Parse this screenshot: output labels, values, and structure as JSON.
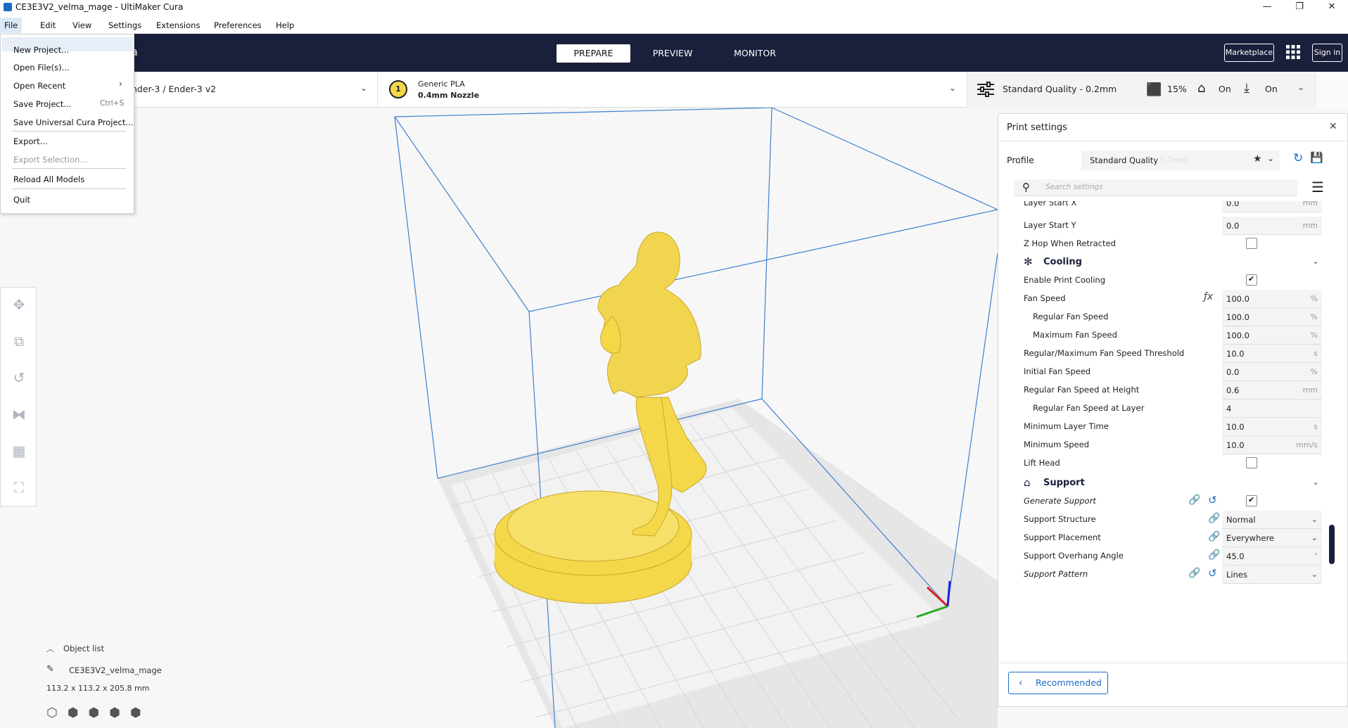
{
  "window": {
    "title": "CE3E3V2_velma_mage - UltiMaker Cura",
    "controls": [
      "—",
      "❐",
      "✕"
    ]
  },
  "menubar": [
    "File",
    "Edit",
    "View",
    "Settings",
    "Extensions",
    "Preferences",
    "Help"
  ],
  "header": {
    "tabs": [
      "PREPARE",
      "PREVIEW",
      "MONITOR"
    ],
    "active_tab": "PREPARE",
    "marketplace_label": "Marketplace",
    "signin_label": "Sign in",
    "logo_fragment": "a"
  },
  "toolbar": {
    "printer": "nder-3 / Ender-3 v2",
    "material_index": "1",
    "material_name": "Generic PLA",
    "nozzle": "0.4mm Nozzle",
    "quality": "Standard Quality - 0.2mm",
    "infill": "15%",
    "support": "On",
    "adhesion": "On"
  },
  "file_menu": {
    "items": [
      {
        "label": "New Project...",
        "shortcut": "",
        "disabled": false
      },
      {
        "label": "Open File(s)...",
        "shortcut": "",
        "disabled": false
      },
      {
        "label": "Open Recent",
        "shortcut": "›",
        "disabled": false
      },
      {
        "label": "Save Project...",
        "shortcut": "Ctrl+S",
        "disabled": false
      },
      {
        "label": "Save Universal Cura Project...",
        "shortcut": "",
        "disabled": false
      },
      {
        "label": "Export...",
        "shortcut": "",
        "disabled": false
      },
      {
        "label": "Export Selection...",
        "shortcut": "",
        "disabled": true
      },
      {
        "label": "Reload All Models",
        "shortcut": "",
        "disabled": false
      },
      {
        "label": "Quit",
        "shortcut": "",
        "disabled": false
      }
    ]
  },
  "object_list": {
    "title": "Object list",
    "object_name": "CE3E3V2_velma_mage",
    "dimensions": "113.2 x 113.2 x 205.8 mm"
  },
  "print_settings": {
    "title": "Print settings",
    "profile_label": "Profile",
    "profile_value": "Standard Quality",
    "profile_suffix": "0.2mm",
    "search_placeholder": "Search settings",
    "partial_row": "Layer Start X",
    "partial_row_value": "0.0",
    "partial_row_unit": "mm",
    "layer_start_y": {
      "label": "Layer Start Y",
      "value": "0.0",
      "unit": "mm"
    },
    "z_hop": {
      "label": "Z Hop When Retracted"
    },
    "cooling": {
      "title": "Cooling",
      "enable_print_cooling": "Enable Print Cooling",
      "rows": [
        {
          "label": "Fan Speed",
          "value": "100.0",
          "unit": "%"
        },
        {
          "label": "Regular Fan Speed",
          "value": "100.0",
          "unit": "%"
        },
        {
          "label": "Maximum Fan Speed",
          "value": "100.0",
          "unit": "%"
        },
        {
          "label": "Regular/Maximum Fan Speed Threshold",
          "value": "10.0",
          "unit": "s"
        },
        {
          "label": "Initial Fan Speed",
          "value": "0.0",
          "unit": "%"
        },
        {
          "label": "Regular Fan Speed at Height",
          "value": "0.6",
          "unit": "mm"
        },
        {
          "label": "Regular Fan Speed at Layer",
          "value": "4",
          "unit": ""
        },
        {
          "label": "Minimum Layer Time",
          "value": "10.0",
          "unit": "s"
        },
        {
          "label": "Minimum Speed",
          "value": "10.0",
          "unit": "mm/s"
        }
      ],
      "lift_head": "Lift Head"
    },
    "support": {
      "title": "Support",
      "generate_support": "Generate Support",
      "structure": {
        "label": "Support Structure",
        "value": "Normal"
      },
      "placement": {
        "label": "Support Placement",
        "value": "Everywhere"
      },
      "overhang": {
        "label": "Support Overhang Angle",
        "value": "45.0",
        "unit": "°"
      },
      "pattern": {
        "label": "Support Pattern",
        "value": "Lines"
      }
    },
    "recommended_label": "Recommended"
  },
  "colors": {
    "header_bg": "#1a1f3b",
    "model_yellow": "#f5d84a",
    "accent_blue": "#1b6ac9",
    "build_volume_line": "#3d7fd0"
  }
}
